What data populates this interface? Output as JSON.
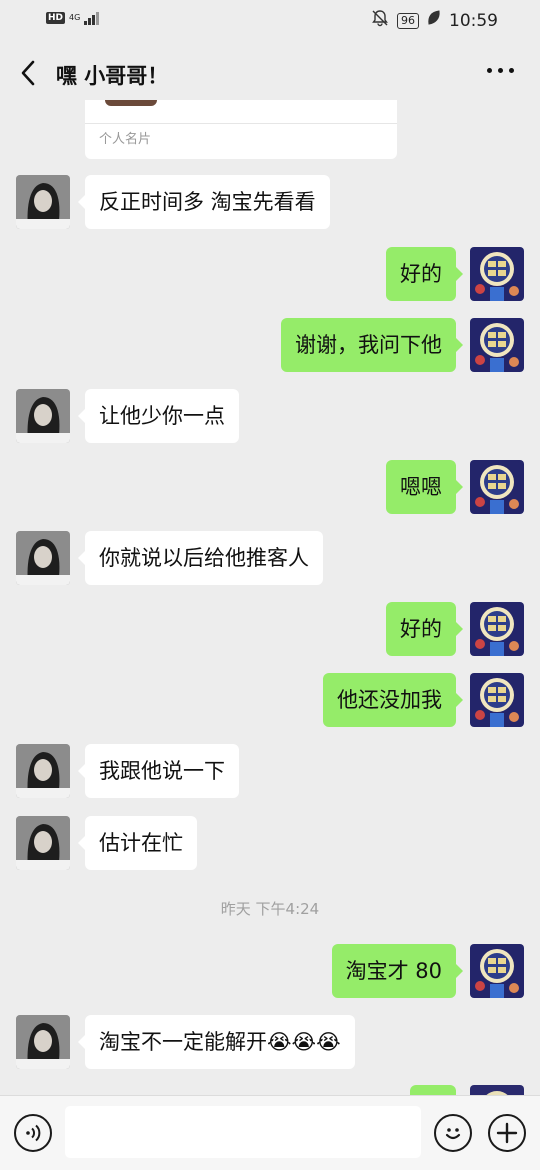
{
  "status_bar": {
    "hd": "HD",
    "network": "4G",
    "battery": "96",
    "time": "10:59"
  },
  "header": {
    "title": "嘿 小哥哥！"
  },
  "card": {
    "label": "个人名片"
  },
  "messages": [
    {
      "side": "in",
      "text": "反正时间多 淘宝先看看"
    },
    {
      "side": "out",
      "text": "好的"
    },
    {
      "side": "out",
      "text": "谢谢，我问下他"
    },
    {
      "side": "in",
      "text": "让他少你一点"
    },
    {
      "side": "out",
      "text": "嗯嗯"
    },
    {
      "side": "in",
      "text": "你就说以后给他推客人"
    },
    {
      "side": "out",
      "text": "好的"
    },
    {
      "side": "out",
      "text": "他还没加我"
    },
    {
      "side": "in",
      "text": "我跟他说一下"
    },
    {
      "side": "in",
      "text": "估计在忙"
    },
    {
      "side": "out",
      "text": "淘宝才 80"
    },
    {
      "side": "in",
      "text": "淘宝不一定能解开😭😭😭"
    }
  ],
  "timestamp": "昨天 下午4:24",
  "icons": {
    "back": "chevron-left-icon",
    "more": "more-dots-icon",
    "voice": "voice-icon",
    "emoji": "emoji-icon",
    "add": "plus-icon"
  },
  "colors": {
    "background": "#ededed",
    "outgoing_bubble": "#95ec69",
    "incoming_bubble": "#ffffff"
  }
}
